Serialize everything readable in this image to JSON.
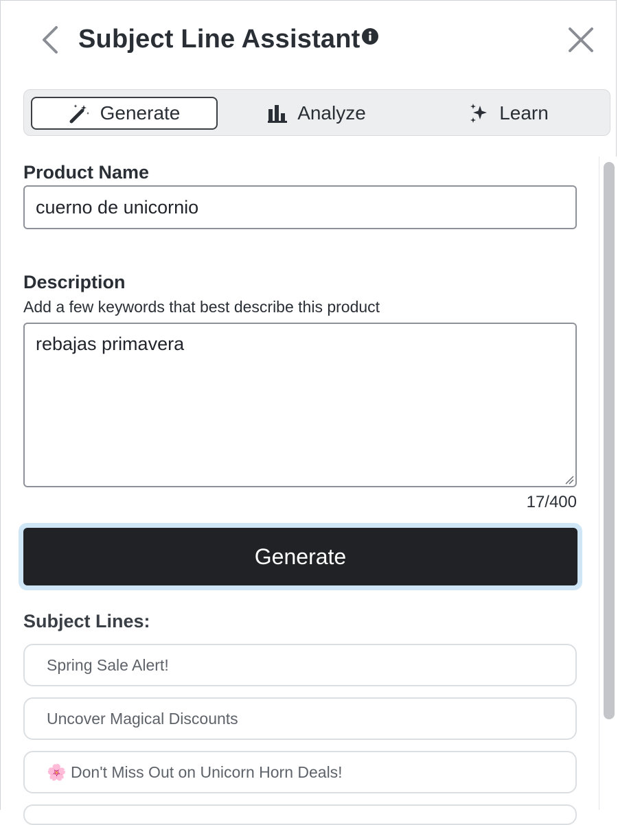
{
  "header": {
    "title": "Subject Line Assistant",
    "back_icon": "chevron-left-icon",
    "info_icon": "info-icon",
    "close_icon": "close-icon"
  },
  "tabs": [
    {
      "label": "Generate",
      "icon": "magic-wand-icon",
      "active": true
    },
    {
      "label": "Analyze",
      "icon": "bar-chart-icon",
      "active": false
    },
    {
      "label": "Learn",
      "icon": "sparkles-icon",
      "active": false
    }
  ],
  "form": {
    "product_name_label": "Product Name",
    "product_name_value": "cuerno de unicornio",
    "description_label": "Description",
    "description_hint": "Add a few keywords that best describe this product",
    "description_value": "rebajas primavera",
    "char_count": "17/400",
    "generate_label": "Generate"
  },
  "results": {
    "heading": "Subject Lines:",
    "items": [
      "Spring Sale Alert!",
      "Uncover Magical Discounts",
      "🌸 Don't Miss Out on Unicorn Horn Deals!"
    ]
  },
  "colors": {
    "primary_button": "#212226",
    "focus_ring": "#cfe6f7",
    "text": "#2a2f36"
  }
}
